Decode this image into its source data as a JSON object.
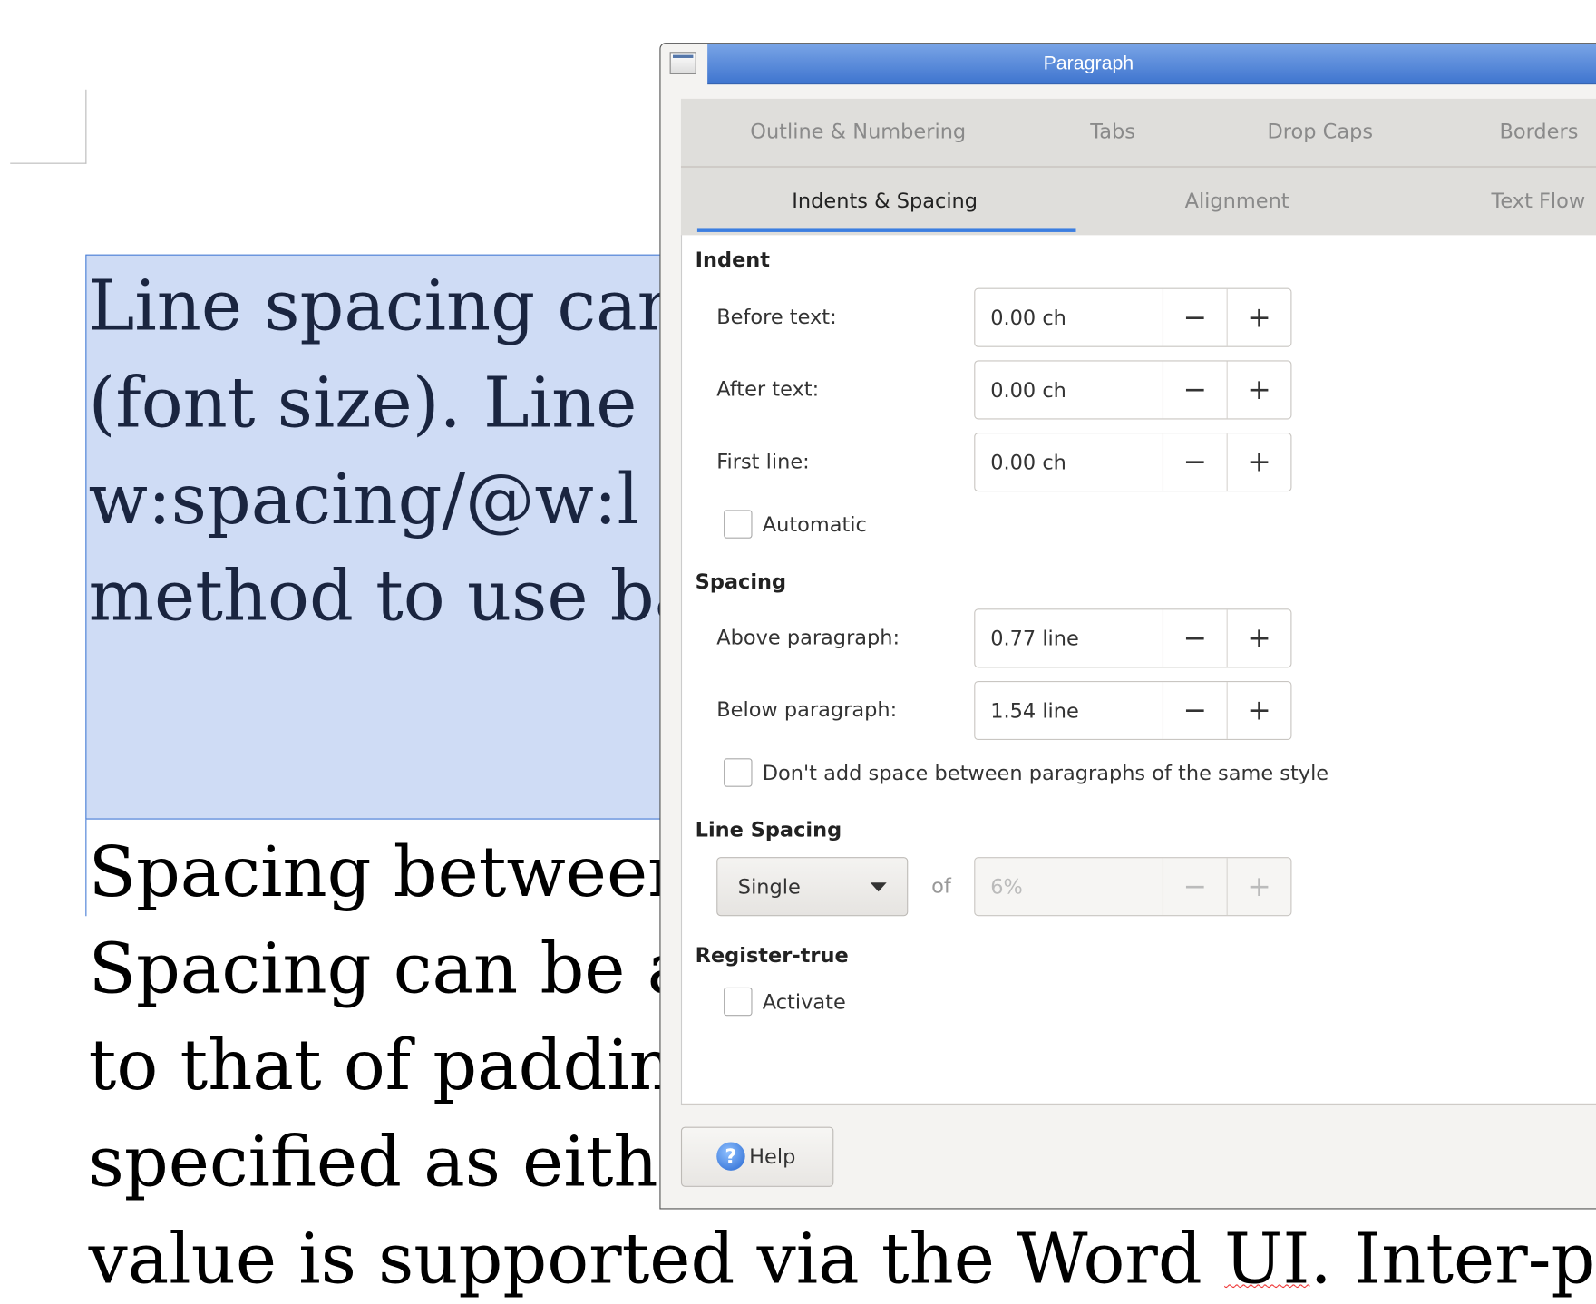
{
  "document": {
    "selected_paragraph": [
      "Line spacing can",
      "(font size). Line s",
      "w:spacing/@w:l",
      "method to use ba"
    ],
    "paragraph2": [
      "Spacing between",
      "Spacing can be a",
      "to that of paddin",
      "specified as eithe"
    ],
    "last_line": {
      "before": "value is supported via the Word ",
      "misspelled": "UI",
      "after": ". Inter-pa"
    }
  },
  "dialog": {
    "title": "Paragraph",
    "tabs_row1": [
      "Outline & Numbering",
      "Tabs",
      "Drop Caps",
      "Borders"
    ],
    "tabs_row2": [
      "Indents & Spacing",
      "Alignment",
      "Text Flow"
    ],
    "active_tab": "Indents & Spacing",
    "indent": {
      "heading": "Indent",
      "before_text": {
        "label": "Before text:",
        "value": "0.00 ch"
      },
      "after_text": {
        "label": "After text:",
        "value": "0.00 ch"
      },
      "first_line": {
        "label": "First line:",
        "value": "0.00 ch"
      },
      "automatic": {
        "label": "Automatic",
        "checked": false
      }
    },
    "spacing": {
      "heading": "Spacing",
      "above": {
        "label": "Above paragraph:",
        "value": "0.77 line"
      },
      "below": {
        "label": "Below paragraph:",
        "value": "1.54 line"
      },
      "dont_add": {
        "label": "Don't add space between paragraphs of the same style",
        "checked": false
      }
    },
    "line_spacing": {
      "heading": "Line Spacing",
      "selected": "Single",
      "of_label": "of",
      "value": "6%"
    },
    "register_true": {
      "heading": "Register-true",
      "activate": {
        "label": "Activate",
        "checked": false
      }
    },
    "help_label": "Help",
    "minus": "−",
    "plus": "+",
    "help_glyph": "?"
  },
  "colors": {
    "accent": "#3c7ee0",
    "selection": "#cfdcf5",
    "titlebar": "#3f75cf"
  }
}
